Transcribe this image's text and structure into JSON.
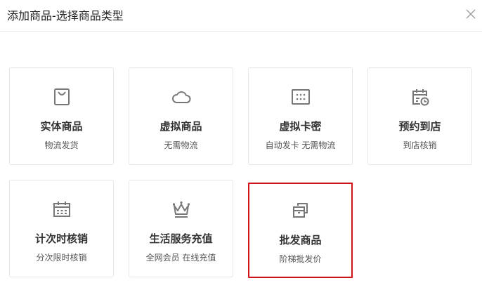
{
  "dialog": {
    "title": "添加商品-选择商品类型",
    "close_icon": "close-icon"
  },
  "cards": [
    {
      "name": "实体商品",
      "desc": "物流发货",
      "icon": "shopping-bag-icon"
    },
    {
      "name": "虚拟商品",
      "desc": "无需物流",
      "icon": "cloud-icon"
    },
    {
      "name": "虚拟卡密",
      "desc": "自动发卡 无需物流",
      "icon": "card-code-icon"
    },
    {
      "name": "预约到店",
      "desc": "到店核销",
      "icon": "calendar-clock-icon"
    },
    {
      "name": "计次时核销",
      "desc": "分次限时核销",
      "icon": "calendar-icon"
    },
    {
      "name": "生活服务充值",
      "desc": "全网会员 在线充值",
      "icon": "crown-icon"
    },
    {
      "name": "批发商品",
      "desc": "阶梯批发价",
      "icon": "boxes-icon"
    }
  ],
  "selected_card": "批发商品",
  "colors": {
    "selected_border": "#d0121b",
    "icon": "#777777"
  }
}
